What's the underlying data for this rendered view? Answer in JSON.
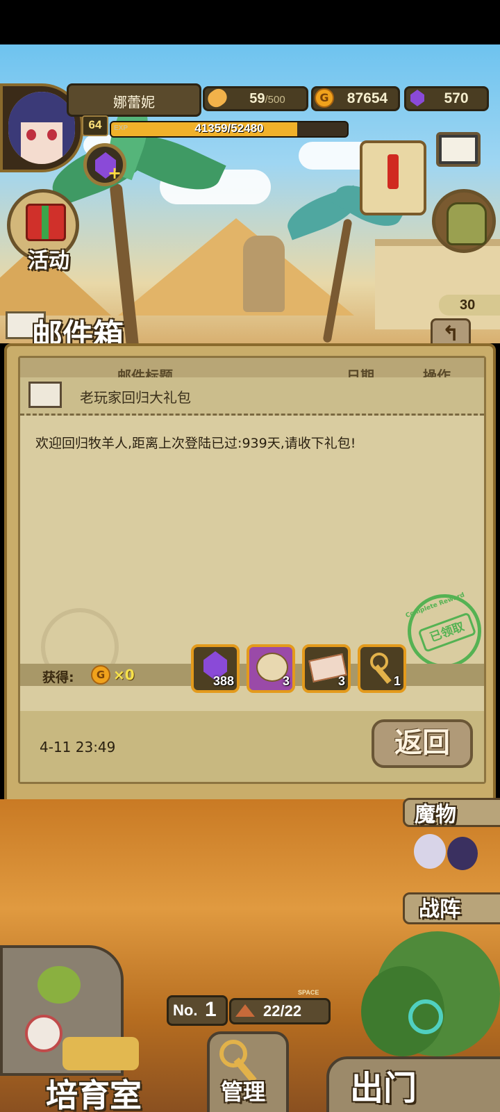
{
  "player": {
    "name": "娜蕾妮",
    "level": "64",
    "exp_tag": "EXP",
    "exp_text": "41359/52480",
    "exp_fraction": 0.788
  },
  "resources": {
    "bread_current": "59",
    "bread_max": "/500",
    "gold": "87654",
    "gems": "570"
  },
  "side_buttons": {
    "activity_label": "活动",
    "event_badge": "30"
  },
  "mailbox": {
    "title": "邮件箱",
    "columns": [
      "邮件标题",
      "日期",
      "操作"
    ],
    "mail_subject": "老玩家回归大礼包",
    "mail_body": "欢迎回归牧羊人,距离上次登陆已过:939天,请收下礼包!",
    "obtain_label": "获得:",
    "gold_amount": "×0",
    "stamp_text": "已领取",
    "stamp_ring_text": "Complete Reward",
    "rewards": [
      {
        "icon": "purple-gem-icon",
        "count": "388"
      },
      {
        "icon": "cotton-bag-icon",
        "count": "3"
      },
      {
        "icon": "ticket-icon",
        "count": "3"
      },
      {
        "icon": "key-icon",
        "count": "1"
      }
    ],
    "date": "4-11 23:49",
    "return_label": "返回"
  },
  "right_menu": {
    "monsters_label": "魔物",
    "formation_label": "战阵"
  },
  "bottom_bar": {
    "rank_prefix": "No.",
    "rank_number": "1",
    "space_tag": "SPACE",
    "space_value": "22/22",
    "nursery_label": "培育室",
    "manage_label": "管理",
    "exit_label": "出门"
  },
  "colors": {
    "exp_fill": "#f0b12a",
    "stamp_green": "#3fae46",
    "slot_border": "#e39a1c",
    "gem_purple": "#8a4ad8"
  }
}
